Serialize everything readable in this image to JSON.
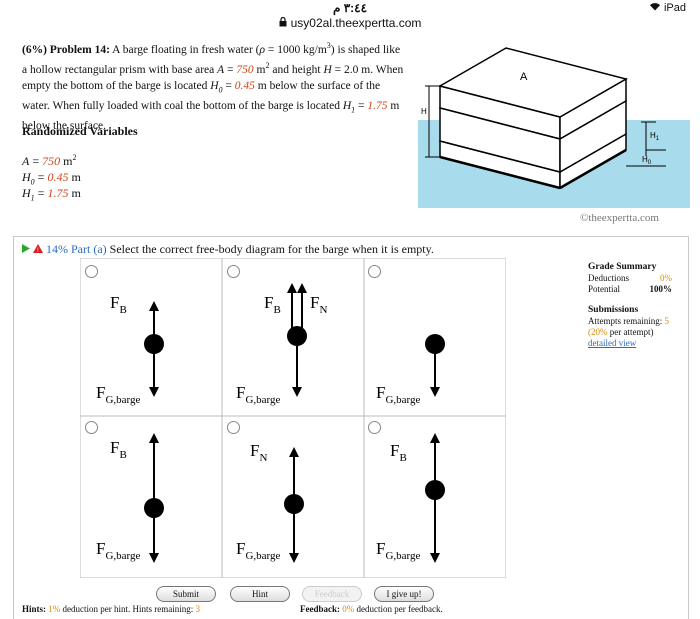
{
  "status": {
    "time": "٣:٤٤ م",
    "url": "usy02al.theexpertta.com",
    "device": "iPad"
  },
  "problem": {
    "prefix": "(6%) Problem 14:",
    "text_1": " A barge floating in fresh water (",
    "rho": "ρ",
    "text_2": " = 1000 kg/m",
    "cube": "3",
    "text_3": ") is shaped like a hollow rectangular prism with base area ",
    "A_sym": "A",
    "eq": " = ",
    "A_val": "750",
    "text_4": " m",
    "sq": "2",
    "text_5": " and height ",
    "H_sym": "H",
    "text_6": " = 2.0 m. When empty the bottom of the barge is located ",
    "H0_sym": "H",
    "H0_sub": "0",
    "H0_val": "0.45",
    "text_7": " m below the surface of the water. When fully loaded with coal the bottom of the barge is located ",
    "H1_sym": "H",
    "H1_sub": "1",
    "H1_val": "1.75",
    "text_8": " m below the surface."
  },
  "randomized": {
    "title": "Randomized Variables",
    "A_label": "A",
    "A_val": "750",
    "A_unit": " m",
    "A_exp": "2",
    "H0_label": "H",
    "H0_sub": "0",
    "H0_val": "0.45",
    "H0_unit": " m",
    "H1_label": "H",
    "H1_sub": "1",
    "H1_val": "1.75",
    "H1_unit": " m"
  },
  "figure": {
    "label_A": "A",
    "label_H": "H",
    "label_H1": "H",
    "label_H1_sub": "1",
    "label_H0": "H",
    "label_H0_sub": "0",
    "credit": "©theexpertta.com"
  },
  "part": {
    "pct": "14% Part (a)",
    "prompt": " Select the correct free-body diagram for the barge when it is empty."
  },
  "fbd": {
    "FB": "F",
    "FB_sub": "B",
    "FN": "F",
    "FN_sub": "N",
    "FG": "F",
    "FG_sub": "G,barge"
  },
  "summary": {
    "title": "Grade Summary",
    "deductions_label": "Deductions",
    "deductions_val": "0%",
    "potential_label": "Potential",
    "potential_val": "100%",
    "submissions_title": "Submissions",
    "attempts_label": "Attempts remaining: ",
    "attempts_val": "5",
    "per_attempt_pct": "(20%",
    "per_attempt_rest": " per attempt)",
    "detailed": "detailed view"
  },
  "buttons": {
    "submit": "Submit",
    "hint": "Hint",
    "feedback": "Feedback",
    "give_up": "I give up!"
  },
  "footer": {
    "hints_label": "Hints:",
    "hints_pct": "1%",
    "hints_text": " deduction per hint. Hints remaining: ",
    "hints_remaining": "3",
    "feedback_label": "Feedback:",
    "feedback_pct": "0%",
    "feedback_text": " deduction per feedback."
  },
  "colors": {
    "water": "#a8dcec",
    "accent_red": "#d0451b",
    "link_blue": "#2a6cc0",
    "orange": "#e08a00"
  }
}
